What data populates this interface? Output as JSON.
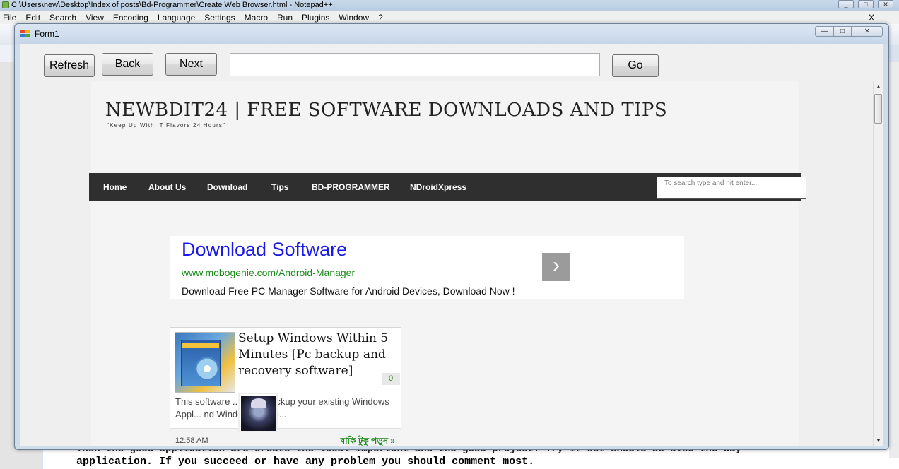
{
  "notepad": {
    "title": "C:\\Users\\new\\Desktop\\Index of posts\\Bd-Programmer\\Create Web Browser.html - Notepad++",
    "menu": [
      "File",
      "Edit",
      "Search",
      "View",
      "Encoding",
      "Language",
      "Settings",
      "Macro",
      "Run",
      "Plugins",
      "Window",
      "?"
    ],
    "menu_close": "X",
    "code_line_partial": "Then the good application are create the local important and the good project. Try it out should be also the way",
    "code_line": "application. If you succeed or have any problem you should comment most."
  },
  "form": {
    "title": "Form1",
    "refresh_label": "Refresh",
    "back_label": "Back",
    "next_label": "Next",
    "url_value": "",
    "go_label": "Go"
  },
  "site": {
    "title": "NEWBDIT24 | FREE SOFTWARE DOWNLOADS AND TIPS",
    "tagline": "\"Keep Up With IT Flavors 24 Hours\"",
    "nav": [
      "Home",
      "About Us",
      "Download",
      "Tips",
      "BD-PROGRAMMER",
      "NDroidXpress"
    ],
    "search_placeholder": "To search type and hit enter..."
  },
  "ad": {
    "title": "Download Software",
    "url": "www.mobogenie.com/Android-Manager",
    "description": "Download Free PC Manager Software for Android Devices, Download Now !",
    "arrow": "›"
  },
  "post": {
    "title": "Setup Windows Within 5 Minutes [Pc backup and recovery software]",
    "comment_count": "0",
    "excerpt": "This software ... ue to backup your existing Windows Appl... nd Windows can b...",
    "time": "12:58 AM",
    "read_more": "বাকি টুকু পড়ুন »"
  },
  "colors": {
    "nav_bg": "#2f2f2f",
    "ad_title": "#1a1ae8",
    "ad_url": "#1a8a1a",
    "read_more": "#1a8a1a"
  }
}
